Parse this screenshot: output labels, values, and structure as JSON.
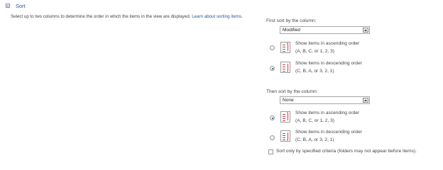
{
  "section": {
    "title": "Sort",
    "description": "Select up to two columns to determine the order in which the items in the view are displayed.",
    "learn_more_link": "Learn about sorting items."
  },
  "first_sort": {
    "label": "First sort by the column:",
    "selected": "Modified",
    "options": [
      {
        "line1": "Show items in ascending order",
        "line2": "(A, B, C, or 1, 2, 3)",
        "checked": false
      },
      {
        "line1": "Show items in descending order",
        "line2": "(C, B, A, or 3, 2, 1)",
        "checked": true
      }
    ]
  },
  "second_sort": {
    "label": "Then sort by the column:",
    "selected": "None",
    "options": [
      {
        "line1": "Show items in ascending order",
        "line2": "(A, B, C, or 1, 2, 3)",
        "checked": true
      },
      {
        "line1": "Show items in descending order",
        "line2": "(C, B, A, or 3, 2, 1)",
        "checked": false
      }
    ]
  },
  "criteria_checkbox": {
    "label": "Sort only by specified criteria (folders may not appear before items).",
    "checked": false
  }
}
